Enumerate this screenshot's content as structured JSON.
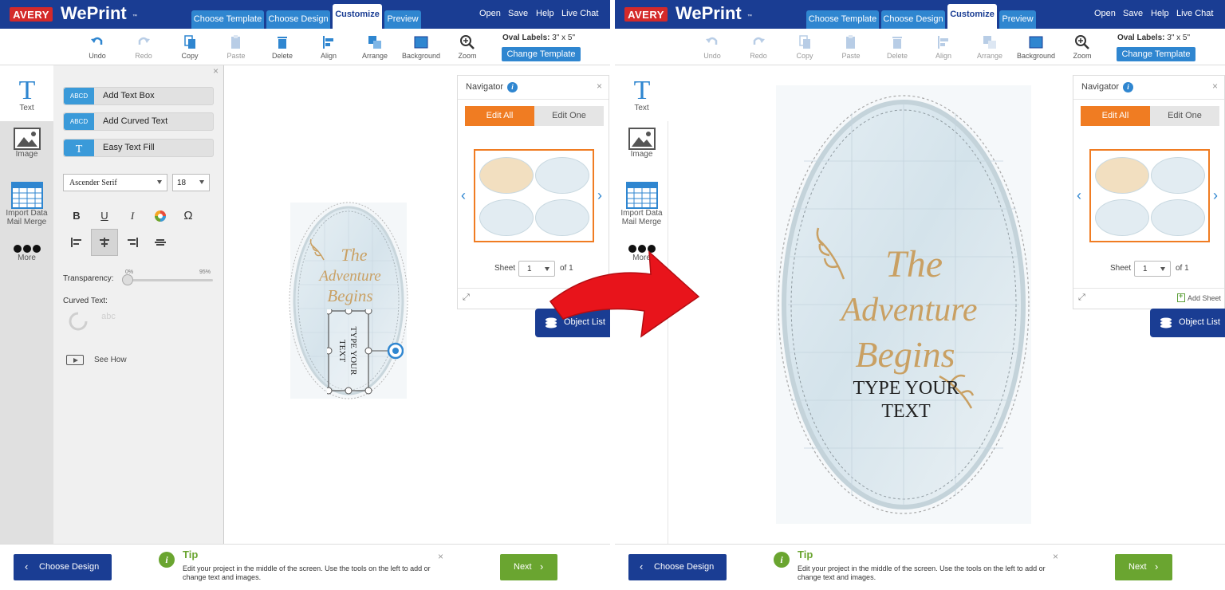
{
  "app": {
    "logo": "AVERY",
    "name": "WePrint",
    "trademark": "™"
  },
  "tabs": [
    {
      "label": "Choose Template"
    },
    {
      "label": "Choose Design"
    },
    {
      "label": "Customize"
    },
    {
      "label": "Preview"
    }
  ],
  "header_links": [
    "Open",
    "Save",
    "Help",
    "Live Chat"
  ],
  "toolbar": {
    "undo": "Undo",
    "redo": "Redo",
    "copy": "Copy",
    "paste": "Paste",
    "delete": "Delete",
    "align": "Align",
    "arrange": "Arrange",
    "background": "Background",
    "zoom": "Zoom"
  },
  "template": {
    "type_label": "Oval Labels:",
    "size": "3\" x 5\"",
    "change_button": "Change Template"
  },
  "sidebar": {
    "text": "Text",
    "image": "Image",
    "import_line1": "Import Data",
    "import_line2": "Mail Merge",
    "more": "More"
  },
  "text_panel": {
    "add_text_box": "Add Text Box",
    "add_text_box_icon": "ABCD",
    "add_curved_text": "Add Curved Text",
    "add_curved_icon": "ABCD",
    "easy_text_fill": "Easy Text Fill",
    "font": "Ascender Serif",
    "size": "18",
    "bold": "B",
    "underline": "U",
    "italic": "I",
    "omega": "Ω",
    "transparency_label": "Transparency:",
    "transparency_min": "0%",
    "transparency_max": "95%",
    "transparency_value": 0,
    "curved_text_label": "Curved Text:",
    "curved_icon_text": "abc",
    "see_how": "See How"
  },
  "label_design": {
    "line1": "The",
    "line2": "Adventure",
    "line3": "Begins",
    "body_line1": "TYPE YOUR",
    "body_line2": "TEXT",
    "mini_label_text": "TYPE YOUR TEXT"
  },
  "navigator": {
    "title": "Navigator",
    "info": "i",
    "close": "×",
    "edit_all": "Edit All",
    "edit_one": "Edit One",
    "sheet_label": "Sheet",
    "sheet_value": "1",
    "of_label": "of 1",
    "add_sheet": "Add Sheet"
  },
  "object_list": "Object List",
  "bottom": {
    "choose_design": "Choose Design",
    "tip_icon": "i",
    "tip_title": "Tip",
    "tip_text": "Edit your project in the middle of the screen. Use the tools on the left to add or change text and images.",
    "close": "×",
    "next": "Next"
  },
  "colors": {
    "brand_blue": "#1a3d93",
    "tab_blue": "#2f86d0",
    "orange": "#f07c22",
    "green": "#6aa530",
    "arrow_red": "#e8141b",
    "gold": "#c9a063"
  }
}
